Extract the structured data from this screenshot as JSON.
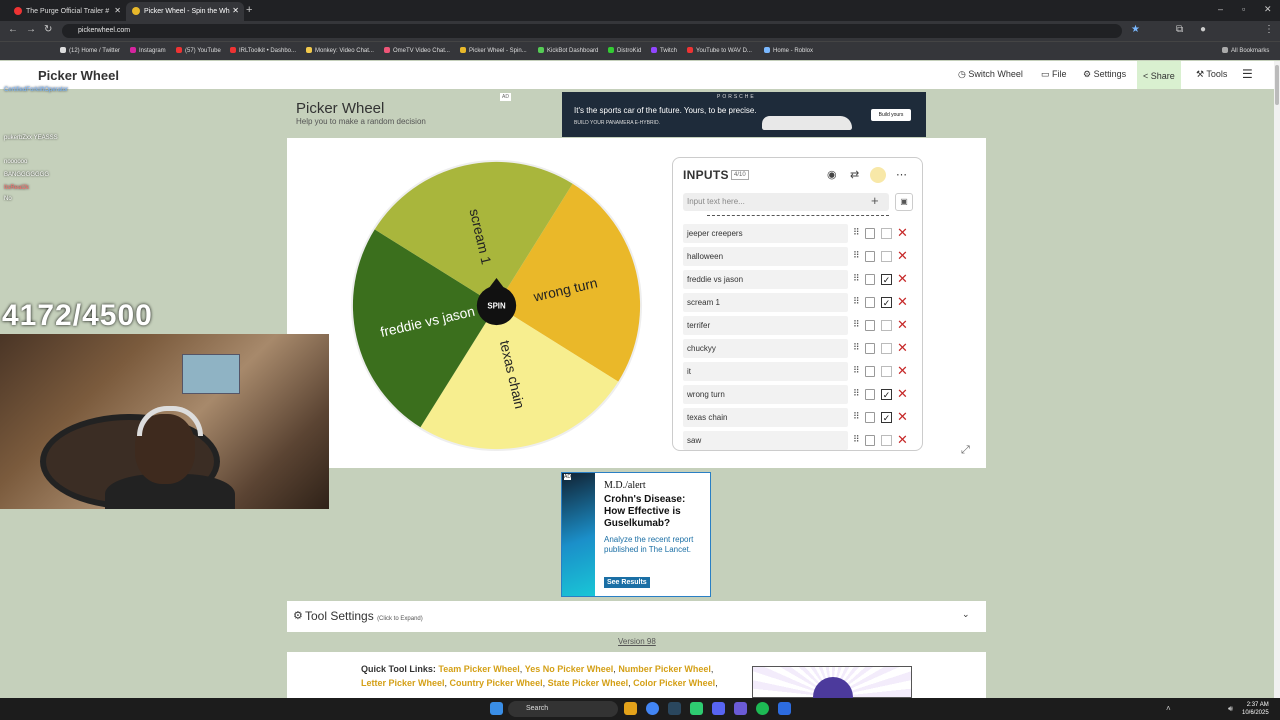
{
  "browser": {
    "tabs": [
      {
        "label": "The Purge Official Trailer #"
      },
      {
        "label": "Picker Wheel - Spin the Wh"
      }
    ],
    "url": "pickerwheel.com",
    "bookmarks": [
      "(12) Home / Twitter",
      "Instagram",
      "(57) YouTube",
      "IRLToolkit • Dashbo...",
      "Monkey: Video Chat...",
      "OmeTV Video Chat...",
      "Picker Wheel - Spin...",
      "KickBot Dashboard",
      "DistroKid",
      "Twitch",
      "YouTube to WAV D...",
      "Home - Roblox",
      "All Bookmarks"
    ]
  },
  "site_header": {
    "logo": "Picker Wheel",
    "nav": [
      "Switch Wheel",
      "File",
      "Settings",
      "Share",
      "Tools"
    ]
  },
  "picker": {
    "title": "Picker Wheel",
    "subtitle": "Help you to make a random decision",
    "spin_label": "SPIN"
  },
  "wheel": {
    "segments": [
      {
        "label": "wrong turn",
        "color": "#eab829"
      },
      {
        "label": "texas chain",
        "color": "#f7ee8f"
      },
      {
        "label": "freddie vs jason",
        "color": "#3b6f1d"
      },
      {
        "label": "scream 1",
        "color": "#a9b63c"
      }
    ]
  },
  "inputs_panel": {
    "title": "INPUTS",
    "count": "4/10",
    "placeholder": "Input text here...",
    "items": [
      {
        "label": "jeeper creepers",
        "checked": false
      },
      {
        "label": "halloween",
        "checked": false
      },
      {
        "label": "freddie vs jason",
        "checked": true
      },
      {
        "label": "scream 1",
        "checked": true
      },
      {
        "label": "terrifer",
        "checked": false
      },
      {
        "label": "chuckyy",
        "checked": false
      },
      {
        "label": "it",
        "checked": false
      },
      {
        "label": "wrong turn",
        "checked": true
      },
      {
        "label": "texas chain",
        "checked": true
      },
      {
        "label": "saw",
        "checked": false
      }
    ]
  },
  "ad_top": {
    "badge": "AD",
    "brand": "PORSCHE",
    "headline": "It's the sports car of the future. Yours, to be precise.",
    "sub": "BUILD YOUR PANAMERA E-HYBRID.",
    "button": "Build yours"
  },
  "ad_mid": {
    "badge": "AD",
    "logo": "M.D./alert",
    "headline": "Crohn's Disease: How Effective is Guselkumab?",
    "body": "Analyze the recent report published in The Lancet.",
    "button": "See Results"
  },
  "tool_settings": {
    "label": "Tool Settings",
    "hint": "(Click to Expand)"
  },
  "version": "Version 98",
  "quick_links": {
    "label": "Quick Tool Links:",
    "links": [
      "Team Picker Wheel",
      "Yes No Picker Wheel",
      "Number Picker Wheel",
      "Letter Picker Wheel",
      "Country Picker Wheel",
      "State Picker Wheel",
      "Color Picker Wheel"
    ]
  },
  "stream_overlay": {
    "counter": "4172/4500",
    "chat": [
      {
        "user": "CertifiedForkliftOperator",
        "msg": "",
        "color": "#7ab8ff"
      },
      {
        "user": "pukerbZxx",
        "msg": "YEASSS",
        "color": "#ffffff"
      },
      {
        "user": "ItsReal2k",
        "msg": "",
        "color": "#ff6b6b"
      },
      {
        "user": "",
        "msg": "BANGGGGGGG",
        "color": "#ffffff"
      },
      {
        "user": "",
        "msg": "noooooo",
        "color": "#ffffff"
      },
      {
        "user": "",
        "msg": "No",
        "color": "#ffffff"
      }
    ]
  },
  "taskbar": {
    "search": "Search",
    "time": "2:37 AM",
    "date": "10/6/2025"
  }
}
